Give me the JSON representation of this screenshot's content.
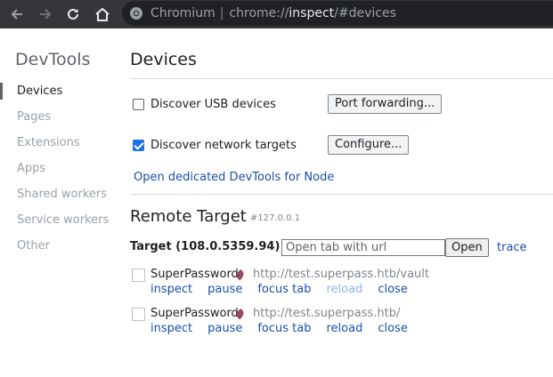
{
  "browser": {
    "site_name": "Chromium",
    "separator": "|",
    "url_scheme": "chrome://",
    "url_host": "inspect",
    "url_path": "/#devices"
  },
  "sidebar": {
    "title": "DevTools",
    "items": [
      {
        "label": "Devices"
      },
      {
        "label": "Pages"
      },
      {
        "label": "Extensions"
      },
      {
        "label": "Apps"
      },
      {
        "label": "Shared workers"
      },
      {
        "label": "Service workers"
      },
      {
        "label": "Other"
      }
    ]
  },
  "main": {
    "title": "Devices",
    "usb": {
      "label": "Discover USB devices",
      "checked": false,
      "button": "Port forwarding..."
    },
    "network": {
      "label": "Discover network targets",
      "checked": true,
      "button": "Configure..."
    },
    "node_link": "Open dedicated DevTools for Node",
    "remote": {
      "title": "Remote Target",
      "address": "#127.0.0.1",
      "target_label": "Target (108.0.5359.94)",
      "url_placeholder": "Open tab with url",
      "open_button": "Open",
      "trace_link": "trace",
      "entries": [
        {
          "name": "SuperPassword",
          "url": "http://test.superpass.htb/vault",
          "actions": {
            "inspect": "inspect",
            "pause": "pause",
            "focus_tab": "focus tab",
            "reload": "reload",
            "close": "close"
          },
          "reload_enabled": false
        },
        {
          "name": "SuperPassword",
          "url": "http://test.superpass.htb/",
          "actions": {
            "inspect": "inspect",
            "pause": "pause",
            "focus_tab": "focus tab",
            "reload": "reload",
            "close": "close"
          },
          "reload_enabled": true
        }
      ]
    }
  },
  "colors": {
    "toolbar": "#35363a",
    "omnibox": "#202124",
    "link": "#1a4fa8",
    "checkbox_checked": "#1a73e8"
  }
}
